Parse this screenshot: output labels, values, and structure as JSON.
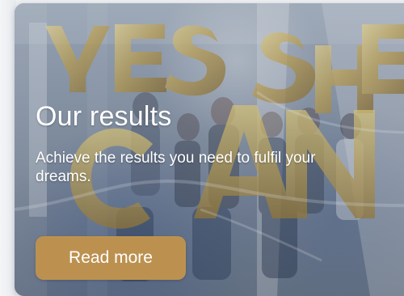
{
  "card": {
    "title": "Our results",
    "description": "Achieve the results you need to fulfil your dreams.",
    "button_label": "Read more"
  },
  "photo": {
    "balloon_letters_top": "YESSHE",
    "balloon_letters_bottom": "CAN"
  },
  "colors": {
    "button": "#bc9150",
    "text": "#ffffff",
    "page_background": "#eef0f3"
  }
}
